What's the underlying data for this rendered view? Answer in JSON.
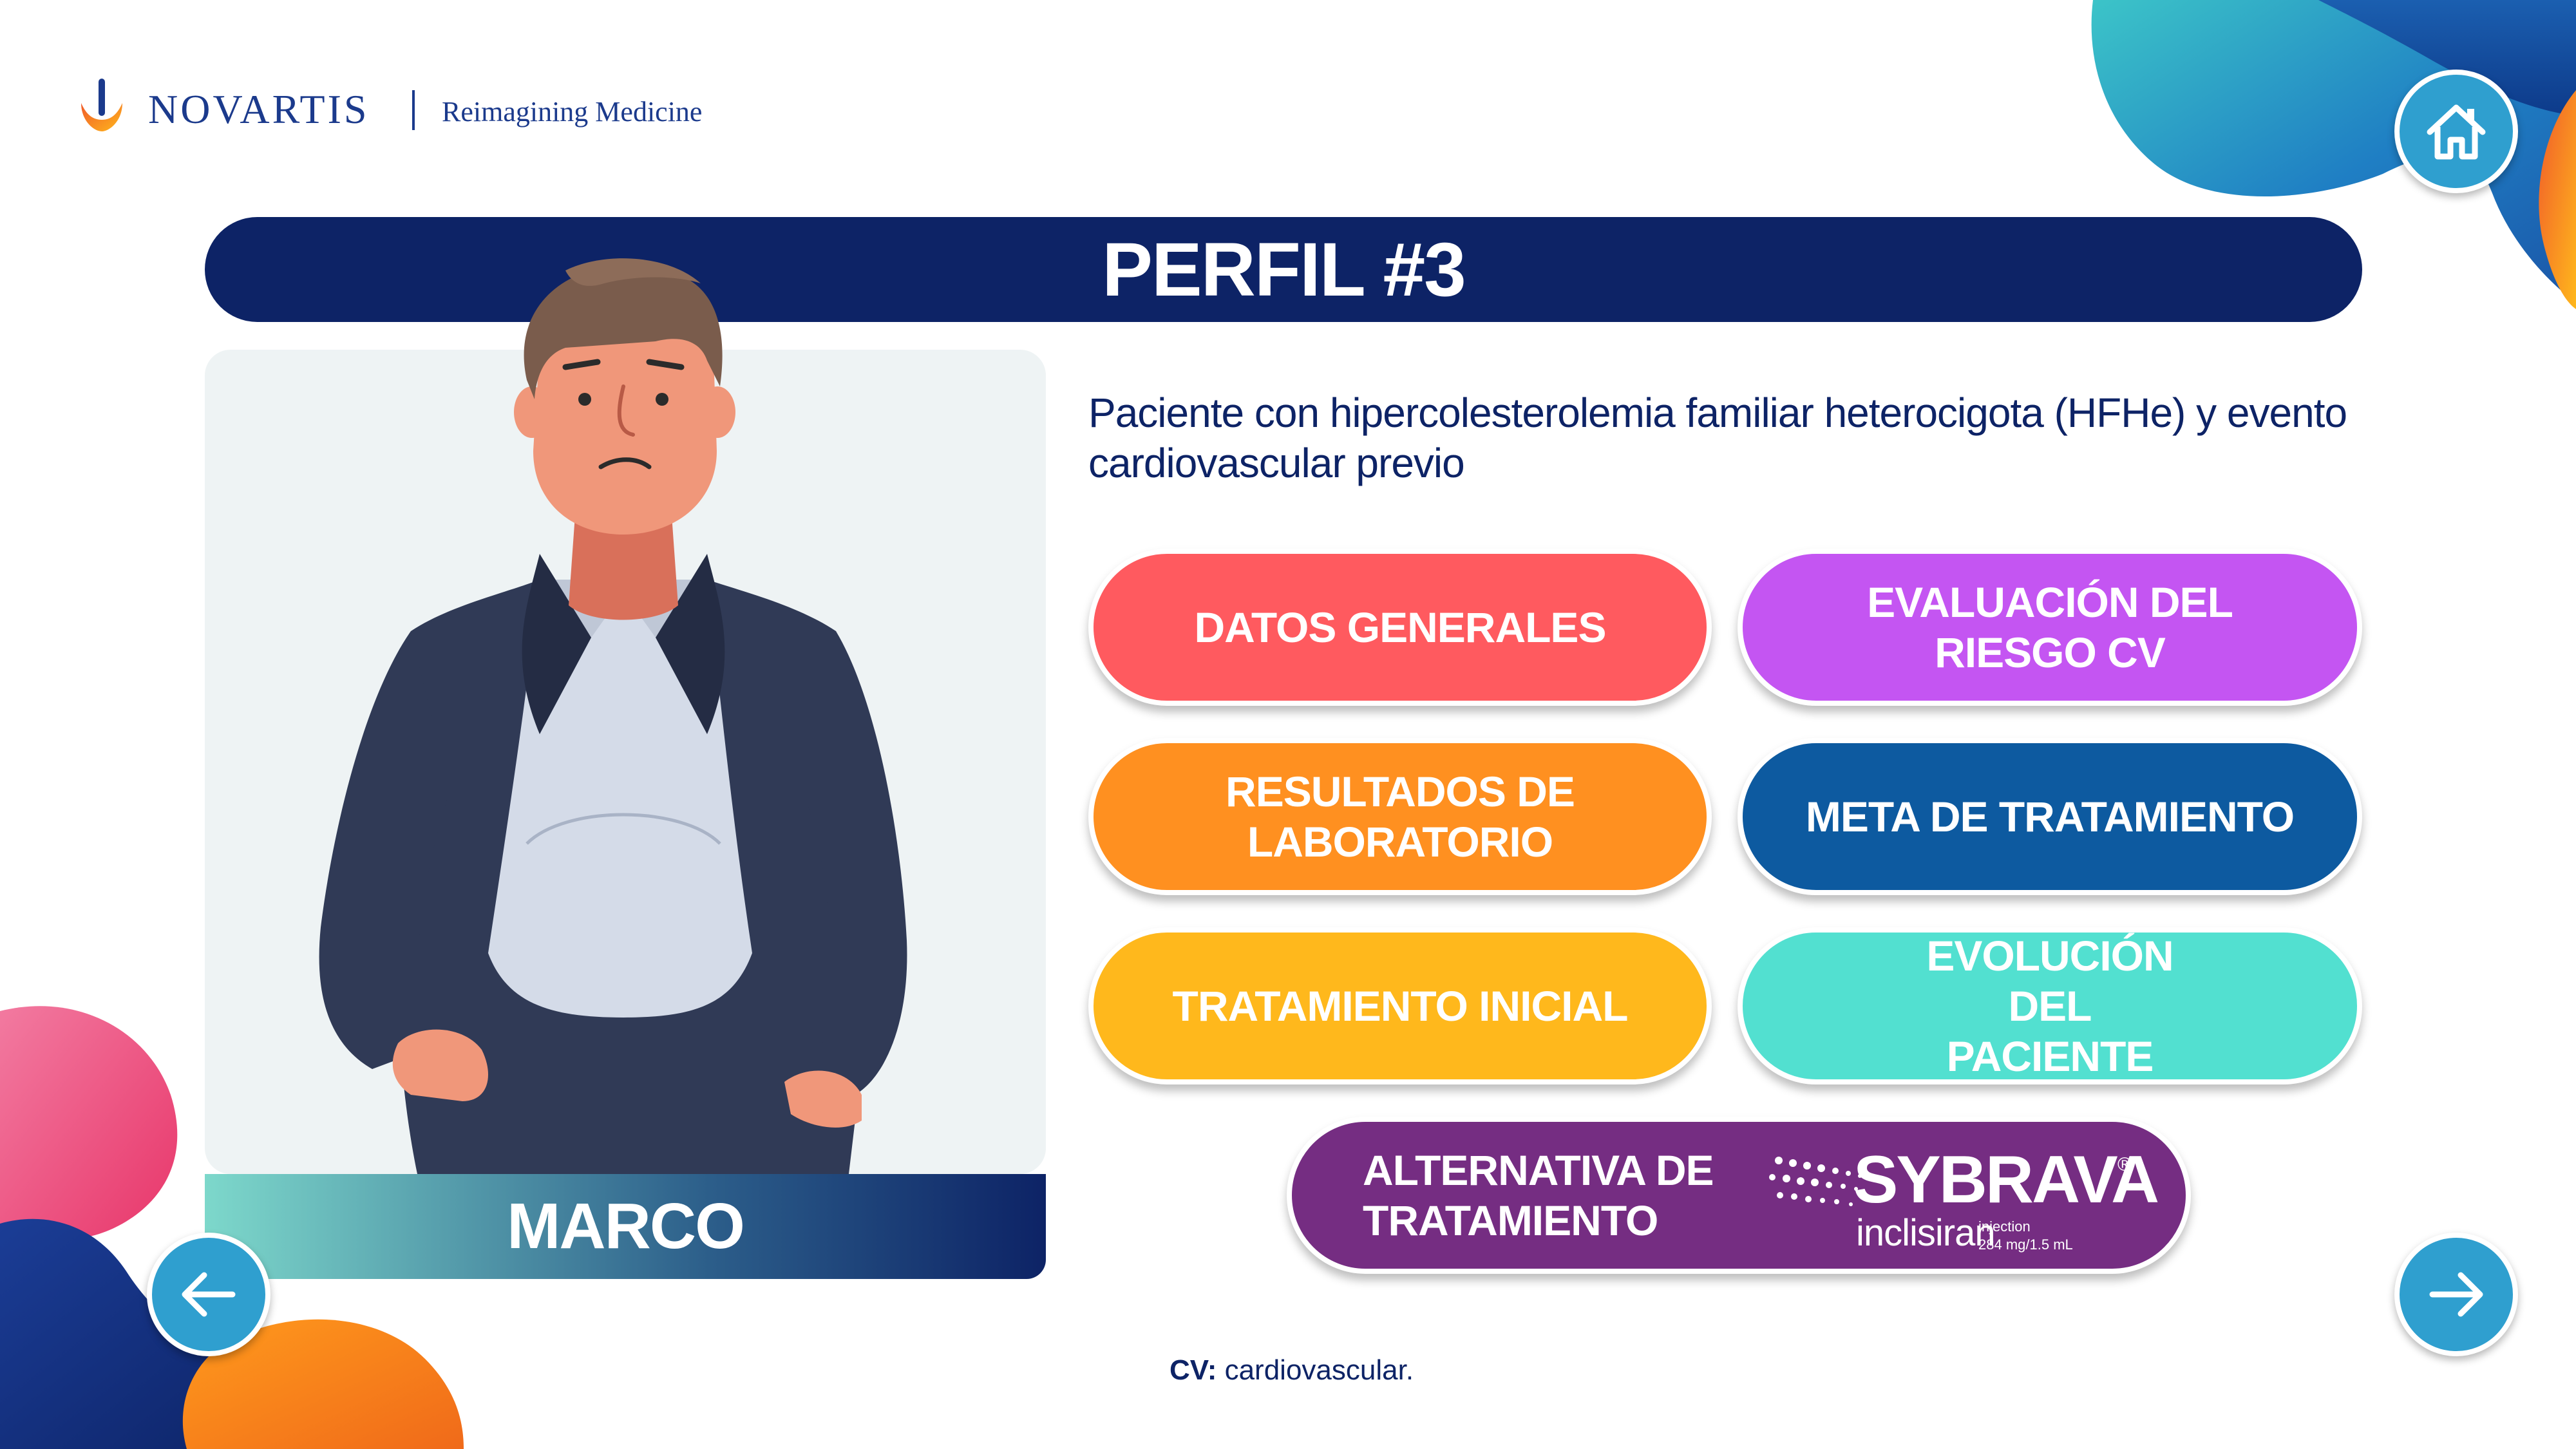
{
  "brand": {
    "name": "NOVARTIS",
    "tagline": "Reimagining Medicine"
  },
  "page": {
    "title": "PERFIL #3",
    "patient_name": "MARCO",
    "description": "Paciente con hipercolesterolemia familiar heterocigota (HFHe) y evento cardiovascular previo"
  },
  "menu": {
    "datos_generales": "DATOS GENERALES",
    "evaluacion_riesgo": "EVALUACIÓN DEL RIESGO CV",
    "resultados_lab": "RESULTADOS DE LABORATORIO",
    "meta_tratamiento": "META DE TRATAMIENTO",
    "tratamiento_inicial": "TRATAMIENTO INICIAL",
    "evolucion_paciente": "EVOLUCIÓN DEL PACIENTE",
    "alternativa": "ALTERNATIVA DE TRATAMIENTO"
  },
  "product": {
    "name": "SYBRAVA",
    "registered": "®",
    "generic": "inclisiran",
    "form": "injection",
    "dose": "284 mg/1.5 mL"
  },
  "footnote": {
    "abbr": "CV:",
    "text": " cardiovascular."
  },
  "icons": {
    "home": "home-icon",
    "prev": "arrow-left-icon",
    "next": "arrow-right-icon",
    "logo": "novartis-logo-icon"
  },
  "colors": {
    "navy": "#0d2366",
    "red": "#ff5a5f",
    "purple": "#c455f2",
    "orange": "#ff9020",
    "blue": "#0d5aa0",
    "yellow": "#ffb81c",
    "teal": "#52e0d0",
    "plum": "#752d82"
  }
}
